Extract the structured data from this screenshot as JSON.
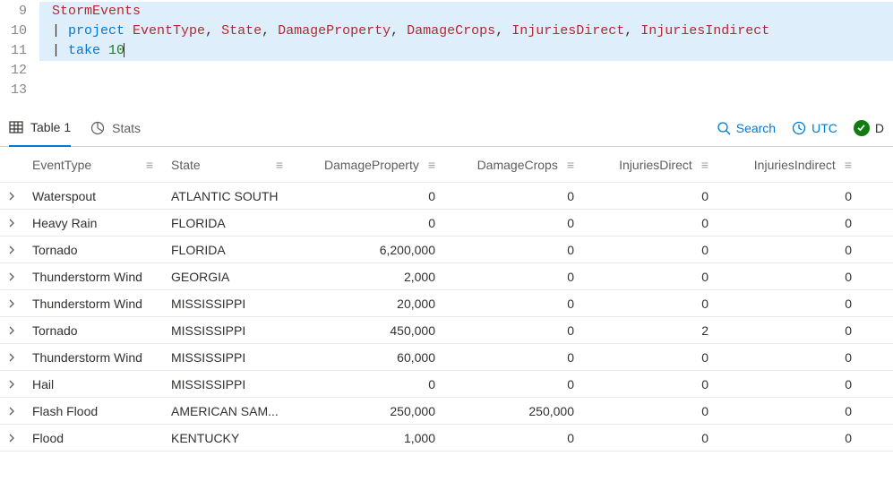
{
  "editor": {
    "lines": [
      {
        "num": "9",
        "hl": true,
        "segs": [
          [
            "ident",
            "StormEvents"
          ]
        ]
      },
      {
        "num": "10",
        "hl": true,
        "segs": [
          [
            "plain",
            "| "
          ],
          [
            "kw",
            "project"
          ],
          [
            "plain",
            " "
          ],
          [
            "ident",
            "EventType"
          ],
          [
            "plain",
            ", "
          ],
          [
            "ident",
            "State"
          ],
          [
            "plain",
            ", "
          ],
          [
            "ident",
            "DamageProperty"
          ],
          [
            "plain",
            ", "
          ],
          [
            "ident",
            "DamageCrops"
          ],
          [
            "plain",
            ", "
          ],
          [
            "ident",
            "InjuriesDirect"
          ],
          [
            "plain",
            ", "
          ],
          [
            "ident",
            "InjuriesIndirect"
          ]
        ]
      },
      {
        "num": "11",
        "hl": true,
        "segs": [
          [
            "plain",
            "| "
          ],
          [
            "kw",
            "take"
          ],
          [
            "plain",
            " "
          ],
          [
            "num",
            "10"
          ]
        ],
        "cursor": true
      },
      {
        "num": "12",
        "hl": false,
        "segs": []
      },
      {
        "num": "13",
        "hl": false,
        "segs": []
      }
    ]
  },
  "tabs": {
    "table_label": "Table 1",
    "stats_label": "Stats"
  },
  "toolbar": {
    "search_label": "Search",
    "tz_label": "UTC",
    "done_label": "D"
  },
  "columns": [
    {
      "key": "EventType",
      "label": "EventType",
      "align": "left",
      "cls": "c-event"
    },
    {
      "key": "State",
      "label": "State",
      "align": "left",
      "cls": "c-state"
    },
    {
      "key": "DamageProperty",
      "label": "DamageProperty",
      "align": "right",
      "cls": "c-dp"
    },
    {
      "key": "DamageCrops",
      "label": "DamageCrops",
      "align": "right",
      "cls": "c-dc"
    },
    {
      "key": "InjuriesDirect",
      "label": "InjuriesDirect",
      "align": "right",
      "cls": "c-id"
    },
    {
      "key": "InjuriesIndirect",
      "label": "InjuriesIndirect",
      "align": "right",
      "cls": "c-ii"
    }
  ],
  "rows": [
    {
      "EventType": "Waterspout",
      "State": "ATLANTIC SOUTH",
      "DamageProperty": "0",
      "DamageCrops": "0",
      "InjuriesDirect": "0",
      "InjuriesIndirect": "0"
    },
    {
      "EventType": "Heavy Rain",
      "State": "FLORIDA",
      "DamageProperty": "0",
      "DamageCrops": "0",
      "InjuriesDirect": "0",
      "InjuriesIndirect": "0"
    },
    {
      "EventType": "Tornado",
      "State": "FLORIDA",
      "DamageProperty": "6,200,000",
      "DamageCrops": "0",
      "InjuriesDirect": "0",
      "InjuriesIndirect": "0"
    },
    {
      "EventType": "Thunderstorm Wind",
      "State": "GEORGIA",
      "DamageProperty": "2,000",
      "DamageCrops": "0",
      "InjuriesDirect": "0",
      "InjuriesIndirect": "0"
    },
    {
      "EventType": "Thunderstorm Wind",
      "State": "MISSISSIPPI",
      "DamageProperty": "20,000",
      "DamageCrops": "0",
      "InjuriesDirect": "0",
      "InjuriesIndirect": "0"
    },
    {
      "EventType": "Tornado",
      "State": "MISSISSIPPI",
      "DamageProperty": "450,000",
      "DamageCrops": "0",
      "InjuriesDirect": "2",
      "InjuriesIndirect": "0"
    },
    {
      "EventType": "Thunderstorm Wind",
      "State": "MISSISSIPPI",
      "DamageProperty": "60,000",
      "DamageCrops": "0",
      "InjuriesDirect": "0",
      "InjuriesIndirect": "0"
    },
    {
      "EventType": "Hail",
      "State": "MISSISSIPPI",
      "DamageProperty": "0",
      "DamageCrops": "0",
      "InjuriesDirect": "0",
      "InjuriesIndirect": "0"
    },
    {
      "EventType": "Flash Flood",
      "State": "AMERICAN SAM...",
      "DamageProperty": "250,000",
      "DamageCrops": "250,000",
      "InjuriesDirect": "0",
      "InjuriesIndirect": "0"
    },
    {
      "EventType": "Flood",
      "State": "KENTUCKY",
      "DamageProperty": "1,000",
      "DamageCrops": "0",
      "InjuriesDirect": "0",
      "InjuriesIndirect": "0"
    }
  ]
}
